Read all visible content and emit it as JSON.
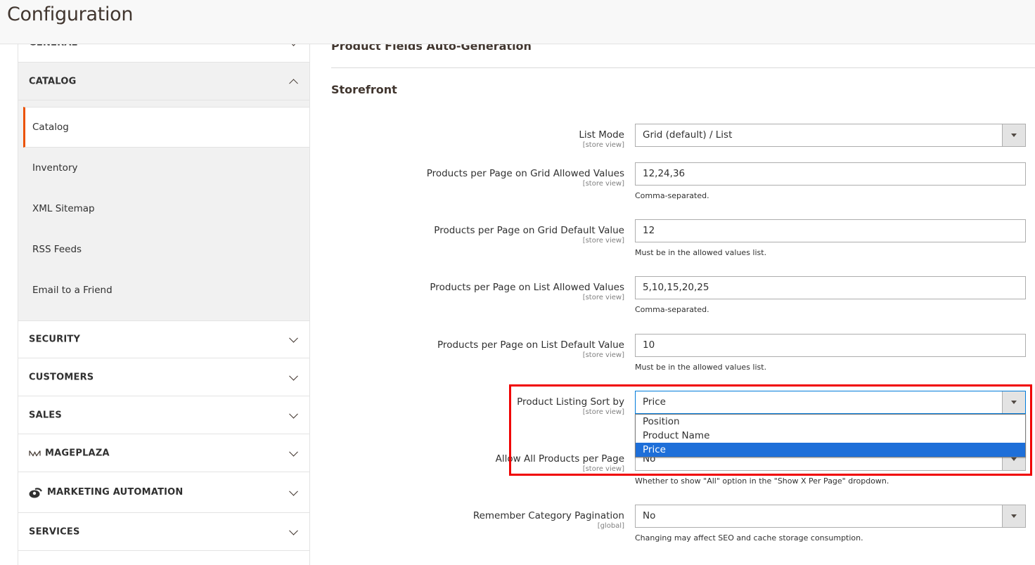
{
  "header": {
    "title": "Configuration"
  },
  "sidebar": {
    "sections": [
      {
        "label": "GENERAL",
        "state": "collapsed"
      },
      {
        "label": "CATALOG",
        "state": "expanded",
        "items": [
          {
            "label": "Catalog",
            "active": true
          },
          {
            "label": "Inventory"
          },
          {
            "label": "XML Sitemap"
          },
          {
            "label": "RSS Feeds"
          },
          {
            "label": "Email to a Friend"
          }
        ]
      },
      {
        "label": "SECURITY",
        "state": "collapsed"
      },
      {
        "label": "CUSTOMERS",
        "state": "collapsed"
      },
      {
        "label": "SALES",
        "state": "collapsed"
      },
      {
        "label": "MAGEPLAZA",
        "state": "collapsed",
        "icon": "mageplaza-logo-icon"
      },
      {
        "label": "MARKETING AUTOMATION",
        "state": "collapsed",
        "icon": "marketing-automation-logo-icon"
      },
      {
        "label": "SERVICES",
        "state": "collapsed"
      }
    ]
  },
  "main": {
    "groups": {
      "auto_generation": "Product Fields Auto-Generation",
      "storefront": "Storefront"
    },
    "fields": [
      {
        "label": "List Mode",
        "scope": "[store view]",
        "type": "select",
        "value": "Grid (default) / List"
      },
      {
        "label": "Products per Page on Grid Allowed Values",
        "scope": "[store view]",
        "type": "text",
        "value": "12,24,36",
        "note": "Comma-separated."
      },
      {
        "label": "Products per Page on Grid Default Value",
        "scope": "[store view]",
        "type": "text",
        "value": "12",
        "note": "Must be in the allowed values list."
      },
      {
        "label": "Products per Page on List Allowed Values",
        "scope": "[store view]",
        "type": "text",
        "value": "5,10,15,20,25",
        "note": "Comma-separated."
      },
      {
        "label": "Products per Page on List Default Value",
        "scope": "[store view]",
        "type": "text",
        "value": "10",
        "note": "Must be in the allowed values list."
      },
      {
        "label": "Product Listing Sort by",
        "scope": "[store view]",
        "type": "select",
        "value": "Price",
        "open": true,
        "options": [
          "Position",
          "Product Name",
          "Price"
        ],
        "highlighted_option": "Price"
      },
      {
        "label": "Allow All Products per Page",
        "scope": "[store view]",
        "type": "select",
        "value": "No",
        "note": "Whether to show \"All\" option in the \"Show X Per Page\" dropdown."
      },
      {
        "label": "Remember Category Pagination",
        "scope": "[global]",
        "type": "select",
        "value": "No",
        "note": "Changing may affect SEO and cache storage consumption."
      }
    ]
  },
  "colors": {
    "active_accent": "#eb5202",
    "selected_option": "#1e6fd9",
    "annotation_box": "#f00000"
  }
}
